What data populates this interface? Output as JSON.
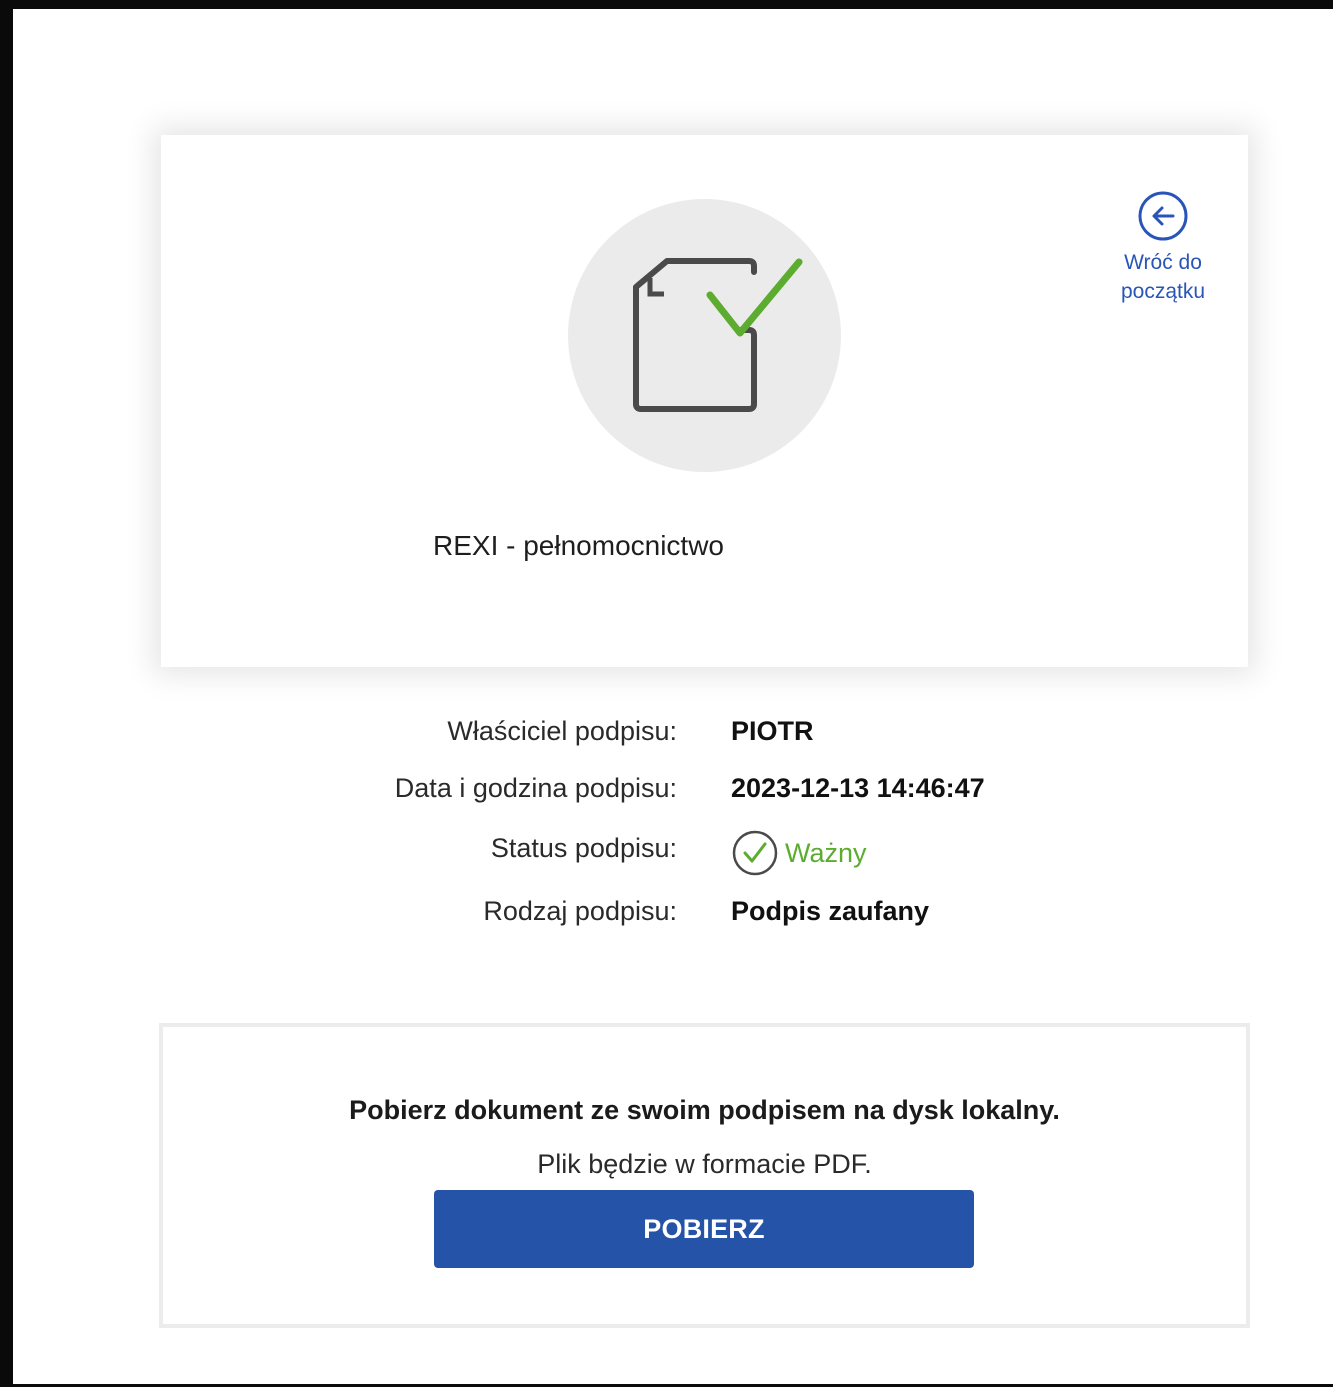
{
  "document": {
    "name": "REXI - pełnomocnictwo",
    "icon": "document-check-icon"
  },
  "back_link": {
    "icon": "arrow-left-circle-icon",
    "label_line1": "Wróć do",
    "label_line2": "początku",
    "color": "#2955b8"
  },
  "signature_info": {
    "owner_label": "Właściciel podpisu:",
    "owner_value": "PIOTR",
    "datetime_label": "Data i godzina podpisu:",
    "datetime_value": "2023-12-13 14:46:47",
    "status_label": "Status podpisu:",
    "status_value": "Ważny",
    "status_icon": "check-circle-icon",
    "status_color": "#5cac2f",
    "type_label": "Rodzaj podpisu:",
    "type_value": "Podpis zaufany"
  },
  "download": {
    "title": "Pobierz dokument ze swoim podpisem na dysk lokalny.",
    "subtitle": "Plik będzie w formacie PDF.",
    "button_label": "POBIERZ",
    "button_color": "#2553a8"
  }
}
